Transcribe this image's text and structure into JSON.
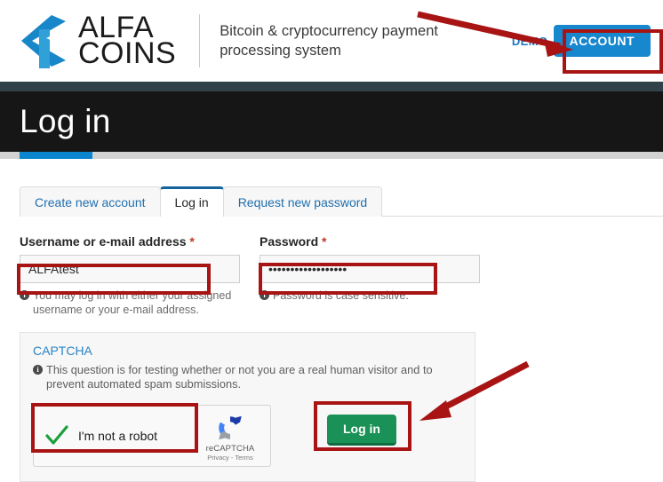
{
  "brand": {
    "logo_icon": "alfacoins-k-logo",
    "name_line1": "ALFA",
    "name_line2": "COINS",
    "tagline": "Bitcoin & cryptocurrency payment processing system"
  },
  "header": {
    "demo_label": "DEMO",
    "account_label": "ACCOUNT",
    "account_color": "#1787ce"
  },
  "page": {
    "title": "Log in",
    "accent_color": "#0a85ce",
    "banner_color": "#161616"
  },
  "tabs": [
    {
      "label": "Create new account",
      "active": false
    },
    {
      "label": "Log in",
      "active": true
    },
    {
      "label": "Request new password",
      "active": false
    }
  ],
  "form": {
    "username": {
      "label": "Username or e-mail address",
      "required_mark": "*",
      "value": "ALFAtest",
      "placeholder": "",
      "help": "You may log in with either your assigned username or your e-mail address."
    },
    "password": {
      "label": "Password",
      "required_mark": "*",
      "value": "••••••••••••••••••",
      "placeholder": "",
      "help": "Password is case sensitive."
    }
  },
  "captcha": {
    "legend": "CAPTCHA",
    "description": "This question is for testing whether or not you are a real human visitor and to prevent automated spam submissions.",
    "checkbox_label": "I'm not a robot",
    "checked": true,
    "check_color": "#1aa03c",
    "brand_name": "reCAPTCHA",
    "brand_legal": "Privacy - Terms"
  },
  "actions": {
    "login_label": "Log in",
    "login_color": "#1a9157"
  },
  "annotations": {
    "highlight_color": "#a81414",
    "boxes": [
      "account-button",
      "username-input",
      "password-input",
      "recaptcha-checkbox",
      "login-button"
    ],
    "arrows": [
      "arrow-to-account-button",
      "arrow-to-login-button"
    ]
  }
}
